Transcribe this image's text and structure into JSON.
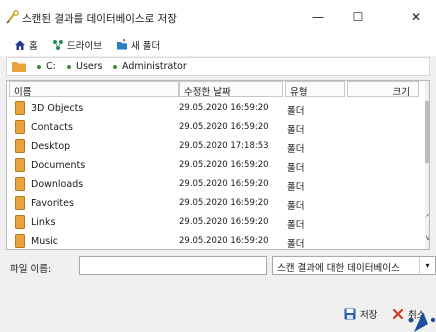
{
  "window": {
    "title": "스캔된 결과를 데이터베이스로 저장",
    "minimize_glyph": "—",
    "maximize_glyph": "☐",
    "close_glyph": "✕"
  },
  "toolbar": {
    "home_label": "홈",
    "drive_label": "드라이브",
    "new_folder_label": "새 폴더"
  },
  "path": {
    "crumbs": [
      "C:",
      "Users",
      "Administrator"
    ]
  },
  "file_list": {
    "columns": {
      "name": "이름",
      "date": "수정한 날짜",
      "type": "유형",
      "size": "크기"
    },
    "rows": [
      {
        "name": "3D Objects",
        "date": "29.05.2020 16:59:20",
        "type": "폴더"
      },
      {
        "name": "Contacts",
        "date": "29.05.2020 16:59:20",
        "type": "폴더"
      },
      {
        "name": "Desktop",
        "date": "29.05.2020 17:18:53",
        "type": "폴더"
      },
      {
        "name": "Documents",
        "date": "29.05.2020 16:59:20",
        "type": "폴더"
      },
      {
        "name": "Downloads",
        "date": "29.05.2020 16:59:20",
        "type": "폴더"
      },
      {
        "name": "Favorites",
        "date": "29.05.2020 16:59:20",
        "type": "폴더"
      },
      {
        "name": "Links",
        "date": "29.05.2020 16:59:20",
        "type": "폴더"
      },
      {
        "name": "Music",
        "date": "29.05.2020 16:59:20",
        "type": "폴더"
      }
    ],
    "scroll_up_glyph": "^",
    "scroll_down_glyph": "v"
  },
  "form": {
    "file_name_label": "파일 이름:",
    "file_name_value": "",
    "file_type_value": "스캔 결과에 대한 데이터베이스",
    "file_type_arrow": "▾"
  },
  "buttons": {
    "save_label": "저장",
    "cancel_label": "취소"
  },
  "colors": {
    "folder": "#e8a33d",
    "save_icon": "#2a5fb0",
    "cancel_icon": "#d23a2a",
    "cursor": "#1f4e9c"
  }
}
